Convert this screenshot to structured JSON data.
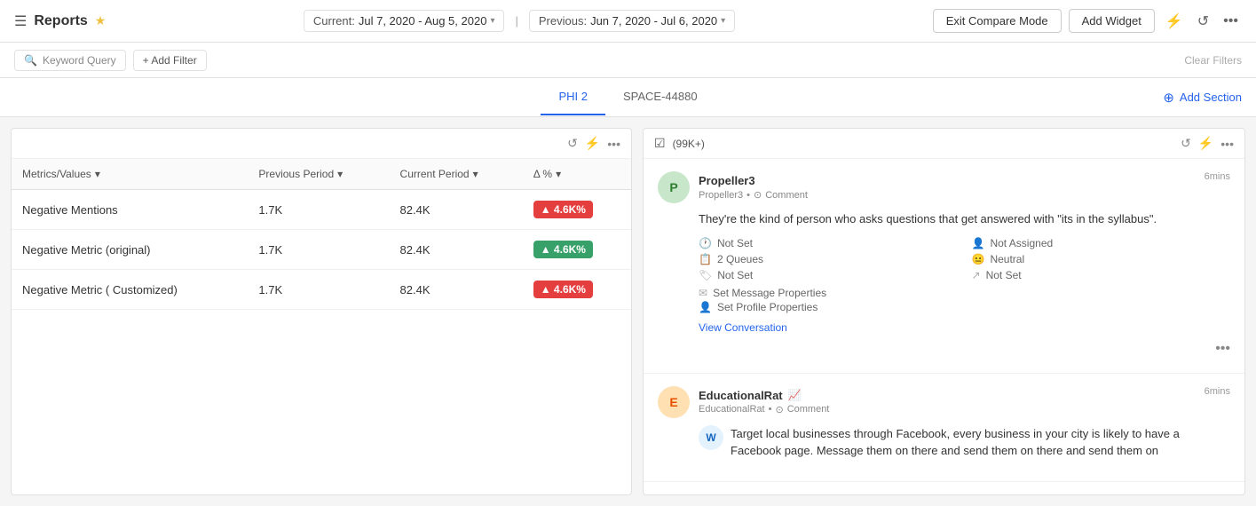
{
  "nav": {
    "hamburger": "☰",
    "title": "Reports",
    "star": "★",
    "current_label": "Current:",
    "current_period": "Jul 7, 2020 - Aug 5, 2020",
    "previous_label": "Previous:",
    "previous_period": "Jun 7, 2020 - Jul 6, 2020",
    "exit_compare_label": "Exit Compare Mode",
    "add_widget_label": "Add Widget"
  },
  "filter_bar": {
    "keyword_placeholder": "Keyword Query",
    "add_filter_label": "+ Add Filter",
    "clear_filters_label": "Clear Filters"
  },
  "tabs": {
    "items": [
      {
        "label": "PHI 2",
        "active": true
      },
      {
        "label": "SPACE-44880",
        "active": false
      }
    ],
    "add_section_label": "Add Section"
  },
  "left_panel": {
    "columns": [
      {
        "label": "Metrics/Values"
      },
      {
        "label": "Previous Period"
      },
      {
        "label": "Current Period"
      },
      {
        "label": "Δ %"
      }
    ],
    "rows": [
      {
        "metric": "Negative Mentions",
        "previous": "1.7K",
        "current": "82.4K",
        "delta": "▲ 4.6K%",
        "delta_type": "red"
      },
      {
        "metric": "Negative Metric (original)",
        "previous": "1.7K",
        "current": "82.4K",
        "delta": "▲ 4.6K%",
        "delta_type": "green"
      },
      {
        "metric": "Negative Metric ( Customized)",
        "previous": "1.7K",
        "current": "82.4K",
        "delta": "▲ 4.6K%",
        "delta_type": "red"
      }
    ]
  },
  "right_panel": {
    "count": "(99K+)",
    "feed": [
      {
        "id": "feed-1",
        "avatar_text": "P",
        "avatar_class": "p3",
        "username": "Propeller3",
        "username_sub": "Propeller3",
        "type": "Comment",
        "time": "6mins",
        "message": "They're the kind of person who asks questions that get answered with \"its in the syllabus\".",
        "meta": [
          {
            "icon": "🕐",
            "label": "Not Set"
          },
          {
            "icon": "👤",
            "label": "Not Assigned"
          },
          {
            "icon": "📋",
            "label": "2 Queues"
          },
          {
            "icon": "😐",
            "label": "Neutral"
          },
          {
            "icon": "🏷",
            "label": "Not Set"
          },
          {
            "icon": "↗",
            "label": "Not Set"
          }
        ],
        "action1": "Set Message Properties",
        "action2": "Set Profile Properties",
        "view_conv": "View Conversation"
      },
      {
        "id": "feed-2",
        "avatar_text": "E",
        "avatar_class": "er",
        "username": "EducationalRat",
        "username_sub": "EducationalRat",
        "type": "Comment",
        "time": "6mins",
        "message": "Target local businesses through Facebook, every business in your city is likely to have a Facebook page. Message them on there and send them on there and send them on",
        "meta": [],
        "view_conv": ""
      }
    ]
  }
}
